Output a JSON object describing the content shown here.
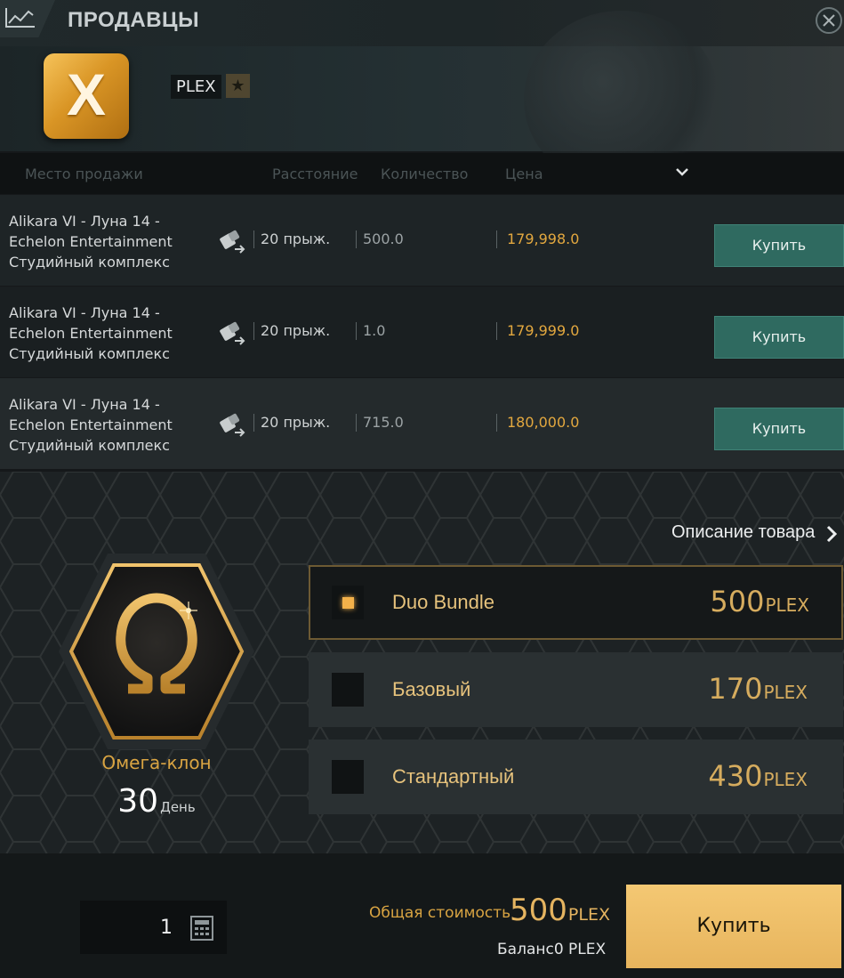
{
  "header": {
    "title": "ПРОДАВЦЫ",
    "item_name": "PLEX",
    "logo_letter": "X",
    "star_glyph": "★"
  },
  "table": {
    "columns": [
      "Место продажи",
      "Расстояние",
      "Количество",
      "Цена"
    ],
    "rows": [
      {
        "location": [
          "Alikara VI - Луна 14 -",
          "Echelon Entertainment",
          "Студийный комплекс"
        ],
        "jumps": "20 прыж.",
        "quantity": "500.0",
        "price": "179,998.0",
        "buy_label": "Купить"
      },
      {
        "location": [
          "Alikara VI - Луна 14 -",
          "Echelon Entertainment",
          "Студийный комплекс"
        ],
        "jumps": "20 прыж.",
        "quantity": "1.0",
        "price": "179,999.0",
        "buy_label": "Купить"
      },
      {
        "location": [
          "Alikara VI - Луна 14 -",
          "Echelon Entertainment",
          "Студийный комплекс"
        ],
        "jumps": "20 прыж.",
        "quantity": "715.0",
        "price": "180,000.0",
        "buy_label": "Купить"
      }
    ]
  },
  "product": {
    "description_link": "Описание товара",
    "name": "Омега-клон",
    "duration_value": "30",
    "duration_unit": "День",
    "options": [
      {
        "label": "Duo Bundle",
        "price": "500",
        "unit": "PLEX",
        "selected": true
      },
      {
        "label": "Базовый",
        "price": "170",
        "unit": "PLEX",
        "selected": false
      },
      {
        "label": "Стандартный",
        "price": "430",
        "unit": "PLEX",
        "selected": false
      }
    ]
  },
  "footer": {
    "quantity": "1",
    "total_label": "Общая стоимость",
    "total_value": "500",
    "total_unit": "PLEX",
    "balance_text": "Баланс0 PLEX",
    "buy_label": "Купить"
  },
  "colors": {
    "accent_gold": "#e3a83f",
    "buy_teal": "#2f6a60",
    "buy_main": "#f4c873"
  }
}
